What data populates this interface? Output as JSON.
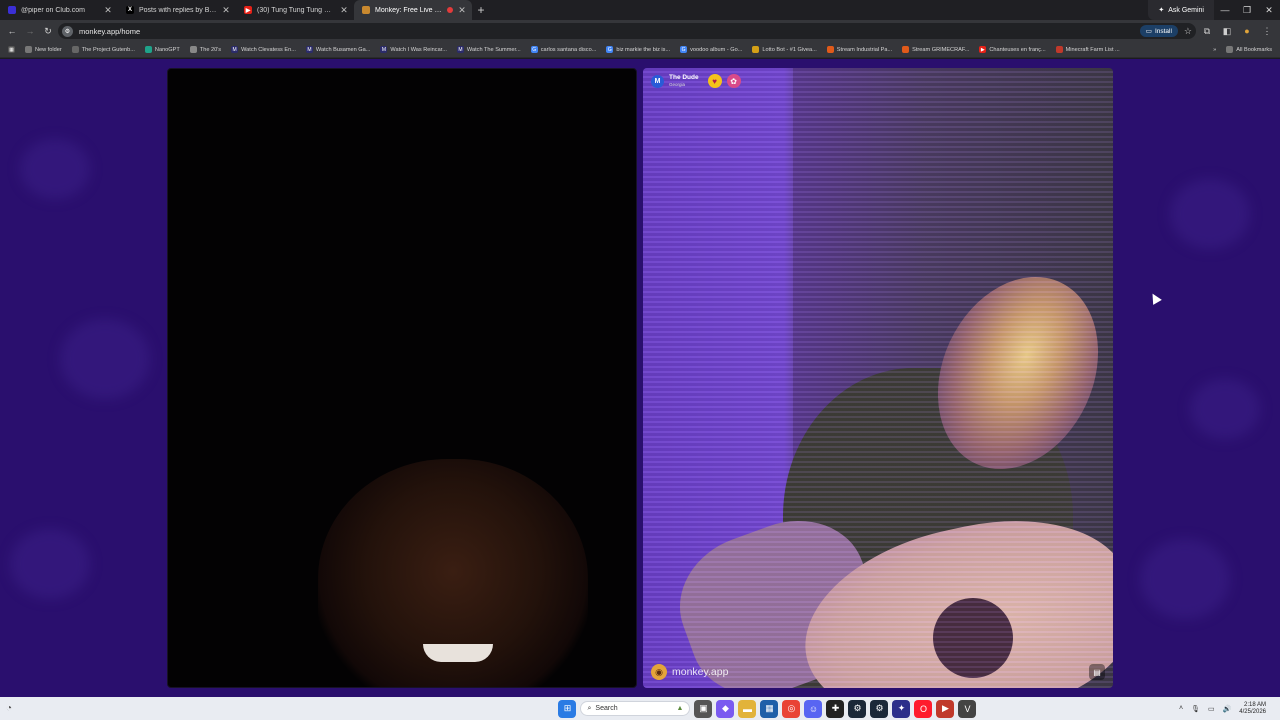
{
  "tabs": [
    {
      "title": "@piper on Club.com",
      "favicon": "club-icon",
      "active": false
    },
    {
      "title": "Posts with replies by Bijan Teh...",
      "favicon": "x-icon",
      "active": false
    },
    {
      "title": "(30) Tung Tung Tung Sahur - Y...",
      "favicon": "youtube-icon",
      "active": false
    },
    {
      "title": "Monkey: Free Live Video Ch...",
      "favicon": "monkey-icon",
      "active": true
    }
  ],
  "ask_gemini": "Ask Gemini",
  "address": {
    "url": "monkey.app/home"
  },
  "install_label": "Install",
  "bookmarks": [
    {
      "label": "New folder",
      "icon": "folder-icon"
    },
    {
      "label": "The Project Gutenb...",
      "icon": "gutenberg-icon"
    },
    {
      "label": "NanoGPT",
      "icon": "nanogpt-icon"
    },
    {
      "label": "The 20's",
      "icon": "globe-icon"
    },
    {
      "label": "Watch Clevatess En...",
      "icon": "m-icon"
    },
    {
      "label": "Watch Busamen Ga...",
      "icon": "m-icon"
    },
    {
      "label": "Watch I Was Reincar...",
      "icon": "m-icon"
    },
    {
      "label": "Watch The Summer...",
      "icon": "m-icon"
    },
    {
      "label": "carlos santana disco...",
      "icon": "google-icon"
    },
    {
      "label": "biz markie the biz is...",
      "icon": "google-icon"
    },
    {
      "label": "voodoo album - Go...",
      "icon": "google-icon"
    },
    {
      "label": "Lotto Bot - #1 Givea...",
      "icon": "lotto-icon"
    },
    {
      "label": "Stream Industrial Pa...",
      "icon": "stream-icon"
    },
    {
      "label": "Stream GRIMECRAF...",
      "icon": "stream-icon"
    },
    {
      "label": "Chanteuses en franç...",
      "icon": "youtube-icon"
    },
    {
      "label": "Minecraft Farm List ...",
      "icon": "minecraft-icon"
    }
  ],
  "all_bookmarks": "All Bookmarks",
  "remote_user": {
    "initial": "M",
    "name": "The Dude",
    "location": "Georgia"
  },
  "watermark": "monkey.app",
  "taskbar": {
    "search_label": "Search",
    "time": "2:18 AM",
    "date": "4/25/2026"
  },
  "colors": {
    "page_bg": "#2a0f6e",
    "accent_install": "#1c3f66",
    "heart_badge": "#f4c21a"
  }
}
